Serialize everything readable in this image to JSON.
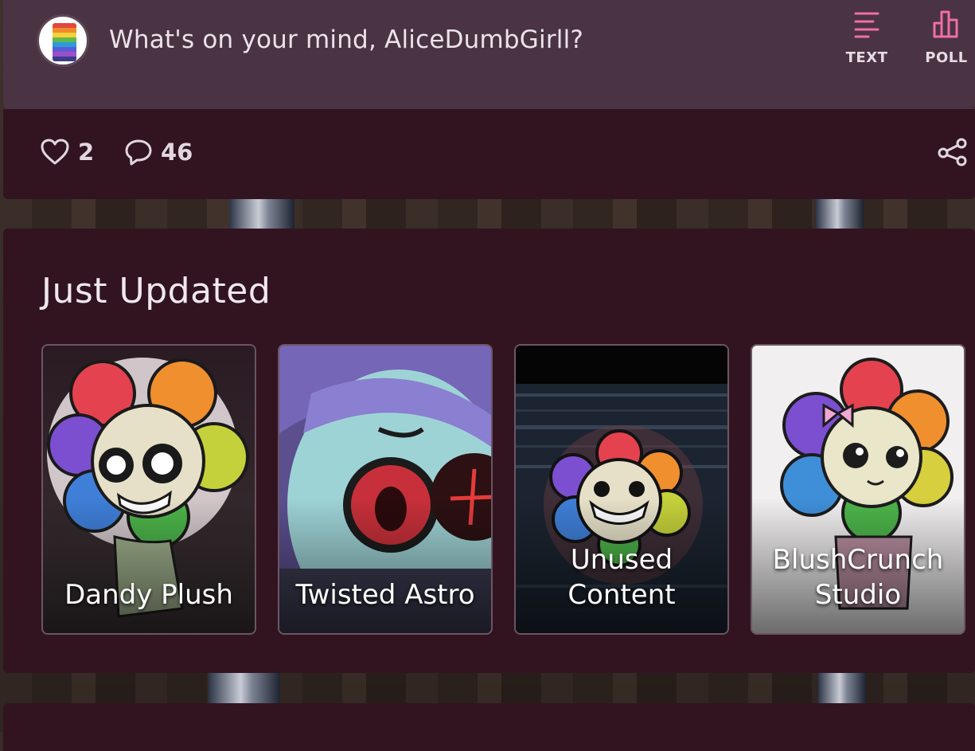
{
  "composer": {
    "prompt": "What's on your mind, AliceDumbGirll?",
    "avatar_icon": "rainbow-stack-avatar",
    "tools": [
      {
        "label": "TEXT",
        "icon": "text-lines-icon"
      },
      {
        "label": "POLL",
        "icon": "poll-bars-icon"
      }
    ]
  },
  "post_footer": {
    "likes": "2",
    "comments": "46",
    "icons": {
      "like": "heart-icon",
      "comment": "comment-bubble-icon",
      "share": "share-icon"
    }
  },
  "just_updated": {
    "title": "Just Updated",
    "cards": [
      {
        "name": "Dandy Plush"
      },
      {
        "name": "Twisted Astro"
      },
      {
        "name": "Unused Content"
      },
      {
        "name": "BlushCrunch Studio"
      }
    ]
  },
  "colors": {
    "accent": "#f06fa0",
    "panel": "#321421",
    "composer": "#4a3342"
  }
}
